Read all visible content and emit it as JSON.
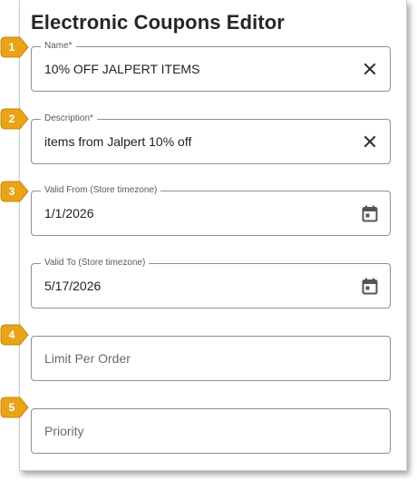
{
  "editor": {
    "title": "Electronic Coupons Editor"
  },
  "fields": {
    "name": {
      "label": "Name*",
      "value": "10% OFF JALPERT ITEMS",
      "trailing_icon": "close-icon"
    },
    "description": {
      "label": "Description*",
      "value": "items from Jalpert 10% off",
      "trailing_icon": "close-icon"
    },
    "valid_from": {
      "label": "Valid From (Store timezone)",
      "value": "1/1/2026",
      "trailing_icon": "calendar-icon"
    },
    "valid_to": {
      "label": "Valid To (Store timezone)",
      "value": "5/17/2026",
      "trailing_icon": "calendar-icon"
    },
    "limit_per_order": {
      "placeholder": "Limit Per Order"
    },
    "priority": {
      "placeholder": "Priority"
    }
  },
  "markers": [
    "1",
    "2",
    "3",
    "4",
    "5"
  ],
  "colors": {
    "marker": "#e8a317",
    "border": "#8f8f8f",
    "title": "#262626"
  }
}
